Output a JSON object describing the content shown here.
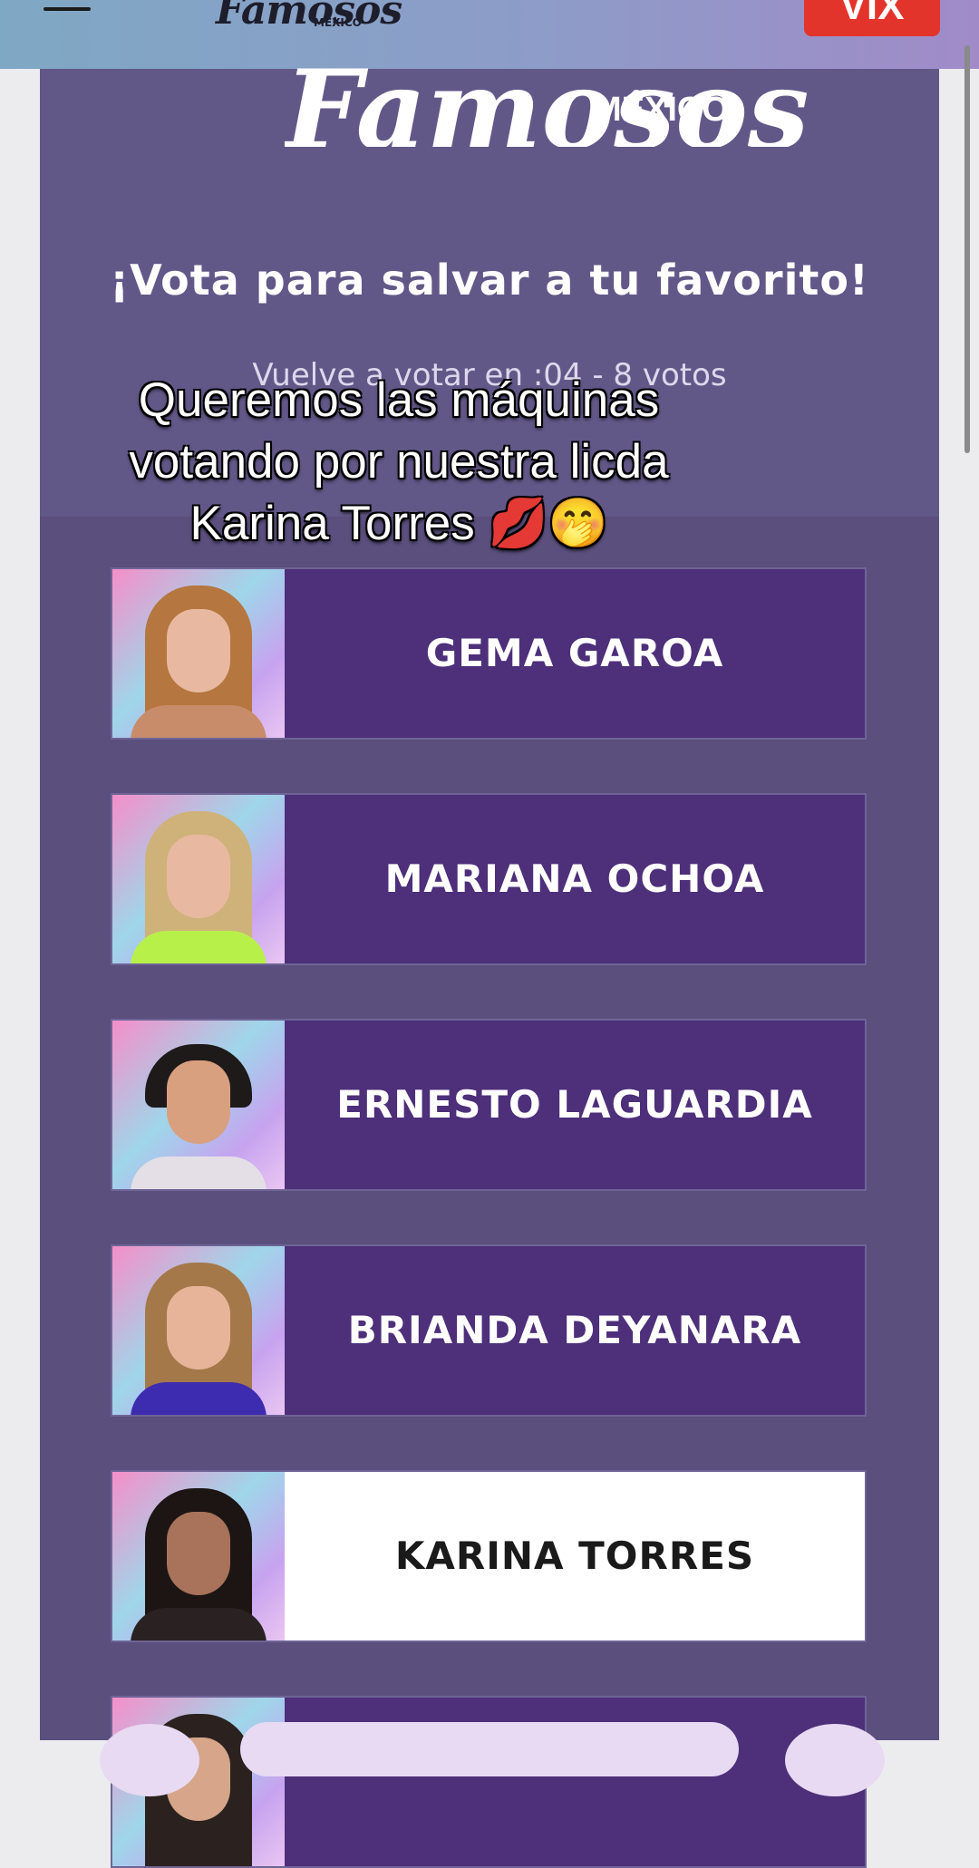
{
  "header": {
    "logo": "Famosos",
    "logo_sub": "MÉXICO",
    "vix_label": "VIX"
  },
  "panel": {
    "logo": "Famosos",
    "logo_sub": "MÉXICO",
    "headline": "¡Vota para salvar a tu favorito!",
    "revote_text": "Vuelve a votar en :04 - 8 votos"
  },
  "candidates": [
    {
      "name": "GEMA GAROA",
      "selected": false
    },
    {
      "name": "MARIANA OCHOA",
      "selected": false
    },
    {
      "name": "ERNESTO LAGUARDIA",
      "selected": false
    },
    {
      "name": "BRIANDA DEYANARA",
      "selected": false
    },
    {
      "name": "KARINA TORRES",
      "selected": true
    }
  ],
  "caption": {
    "line1": "Queremos las máquinas",
    "line2": "votando por nuestra licda",
    "line3": "Karina Torres 💋🤭"
  },
  "colors": {
    "card_bg": "#4d2f7a",
    "card_selected_bg": "#ffffff",
    "panel_bg": "#5a4f7d",
    "vix_red": "#e3342b"
  }
}
